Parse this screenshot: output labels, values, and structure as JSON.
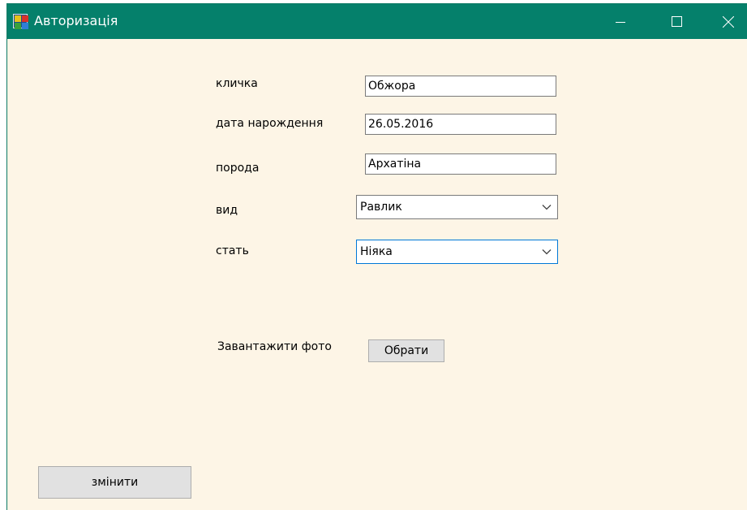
{
  "window": {
    "title": "Авторизація",
    "icon": "app-window-icon",
    "controls": {
      "minimize": "minimize-icon",
      "maximize": "maximize-icon",
      "close": "close-icon"
    },
    "titlebar_color": "#05806b",
    "background_color": "#fdf5e6"
  },
  "form": {
    "nickname": {
      "label": "кличка",
      "value": "Обжора"
    },
    "birth_date": {
      "label": "дата нарождення",
      "value": "26.05.2016"
    },
    "breed": {
      "label": "порода",
      "value": "Архатіна"
    },
    "species": {
      "label": "вид",
      "selected": "Равлик"
    },
    "sex": {
      "label": "стать",
      "selected": "Ніяка"
    },
    "photo": {
      "label": "Завантажити фото",
      "button_label": "Обрати"
    },
    "submit_label": "змінити"
  }
}
